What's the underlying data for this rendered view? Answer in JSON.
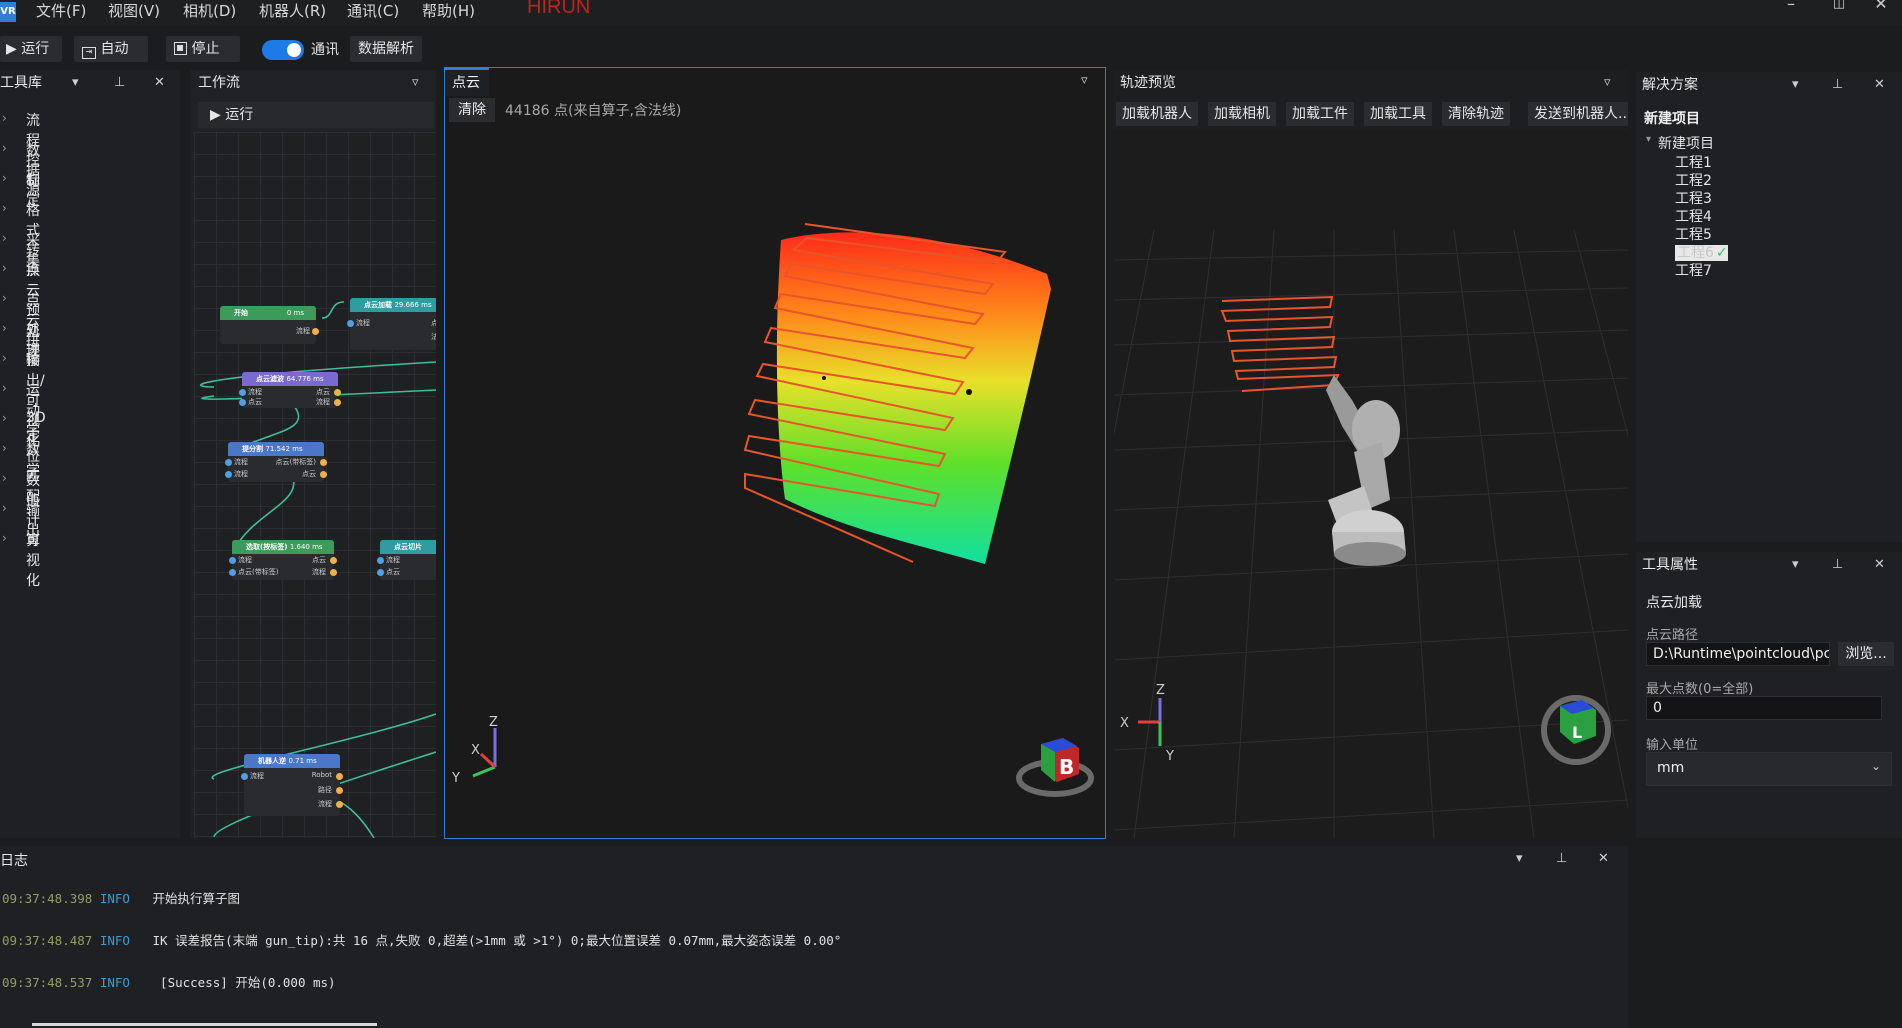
{
  "app": {
    "logo": "VR",
    "brand": "HIRUN"
  },
  "menu": [
    "文件(F)",
    "视图(V)",
    "相机(D)",
    "机器人(R)",
    "通讯(C)",
    "帮助(H)"
  ],
  "window_controls": {
    "minimize": "–",
    "maximize": "◫",
    "close": "✕"
  },
  "toolbar": {
    "run": "运行",
    "auto": "自动",
    "stop": "停止",
    "comm_label": "通讯",
    "comm_enabled": true,
    "parse": "数据解析"
  },
  "tool_library": {
    "title": "工具库",
    "items": [
      "流程控制",
      "数据源",
      "标定",
      "格式转换",
      "采集",
      "点云预处理",
      "点云拼接",
      "轨迹",
      "输出/可视化",
      "运动学",
      "3D定位匹配",
      "数学",
      "数值计算",
      "输出",
      "可视化"
    ]
  },
  "workflow": {
    "title": "工作流",
    "run": "运行",
    "nodes": [
      {
        "title": "开始",
        "time": "0 ms",
        "ports": [
          "流程"
        ]
      },
      {
        "title": "点云加载",
        "time": "29.666 ms",
        "ports": [
          "流程",
          "点",
          "法"
        ]
      },
      {
        "title": "点云滤波",
        "time": "64.776 ms",
        "ports": [
          "流程",
          "点云",
          "点云",
          "流程"
        ]
      },
      {
        "title": "提分割",
        "time": "71.542 ms",
        "ports": [
          "流程",
          "点云(带标签)",
          "点云",
          "流程"
        ]
      },
      {
        "title": "选取(按标签)",
        "time": "1.640 ms",
        "ports": [
          "流程",
          "点云",
          "点云(带标签)",
          "流程"
        ]
      },
      {
        "title": "点云切片",
        "time": "",
        "ports": [
          "流程",
          "点云"
        ]
      },
      {
        "title": "机器人逆",
        "time": "0.71 ms",
        "ports": [
          "流程",
          "Robot",
          "路径",
          "流程"
        ]
      }
    ]
  },
  "pointcloud": {
    "tab": "点云",
    "clear": "清除",
    "info": "44186 点(来自算子,含法线)",
    "axes": {
      "z": "Z",
      "x": "X",
      "y": "Y"
    },
    "cube_label": "B"
  },
  "trajectory": {
    "title": "轨迹预览",
    "buttons": [
      "加载机器人",
      "加载相机",
      "加载工件",
      "加载工具",
      "清除轨迹",
      "发送到机器人..."
    ],
    "axes": {
      "z": "Z",
      "x": "X",
      "y": "Y"
    },
    "cube_label": "L"
  },
  "solution": {
    "title": "解决方案",
    "project": "新建项目",
    "root": "新建项目",
    "items": [
      "工程1",
      "工程2",
      "工程3",
      "工程4",
      "工程5",
      "工程6",
      "工程7"
    ],
    "selected": "工程6"
  },
  "properties": {
    "title": "工具属性",
    "tool_name": "点云加载",
    "path_label": "点云路径",
    "path_value": "D:\\Runtime\\pointcloud\\pc",
    "browse": "浏览...",
    "max_points_label": "最大点数(0=全部)",
    "max_points_value": "0",
    "unit_label": "输入单位",
    "unit_value": "mm"
  },
  "log": {
    "title": "日志",
    "lines": [
      {
        "time": "09:37:48.398",
        "level": "INFO",
        "msg": "开始执行算子图"
      },
      {
        "time": "09:37:48.487",
        "level": "INFO",
        "msg": "IK 误差报告(末端 gun_tip):共 16 点,失败 0,超差(>1mm 或 >1°) 0;最大位置误差 0.07mm,最大姿态误差 0.00°"
      },
      {
        "time": "09:37:48.537",
        "level": "INFO",
        "msg": " [Success] 开始(0.000 ms)"
      }
    ]
  },
  "colors": {
    "accent": "#2f7fd8",
    "brand": "#c0231e",
    "trajectory": "#e8552a"
  }
}
